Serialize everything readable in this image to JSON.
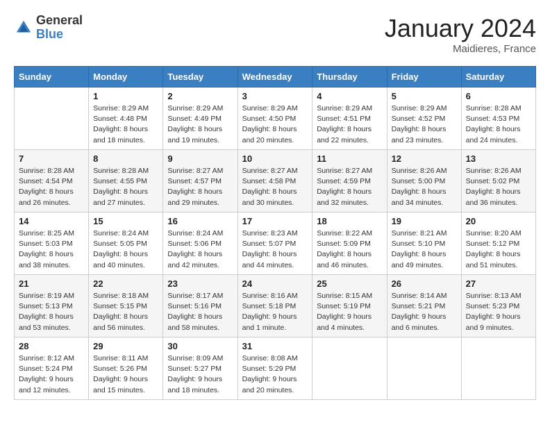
{
  "header": {
    "logo_general": "General",
    "logo_blue": "Blue",
    "month_title": "January 2024",
    "location": "Maidieres, France"
  },
  "weekdays": [
    "Sunday",
    "Monday",
    "Tuesday",
    "Wednesday",
    "Thursday",
    "Friday",
    "Saturday"
  ],
  "weeks": [
    [
      {
        "day": "",
        "sunrise": "",
        "sunset": "",
        "daylight": ""
      },
      {
        "day": "1",
        "sunrise": "Sunrise: 8:29 AM",
        "sunset": "Sunset: 4:48 PM",
        "daylight": "Daylight: 8 hours and 18 minutes."
      },
      {
        "day": "2",
        "sunrise": "Sunrise: 8:29 AM",
        "sunset": "Sunset: 4:49 PM",
        "daylight": "Daylight: 8 hours and 19 minutes."
      },
      {
        "day": "3",
        "sunrise": "Sunrise: 8:29 AM",
        "sunset": "Sunset: 4:50 PM",
        "daylight": "Daylight: 8 hours and 20 minutes."
      },
      {
        "day": "4",
        "sunrise": "Sunrise: 8:29 AM",
        "sunset": "Sunset: 4:51 PM",
        "daylight": "Daylight: 8 hours and 22 minutes."
      },
      {
        "day": "5",
        "sunrise": "Sunrise: 8:29 AM",
        "sunset": "Sunset: 4:52 PM",
        "daylight": "Daylight: 8 hours and 23 minutes."
      },
      {
        "day": "6",
        "sunrise": "Sunrise: 8:28 AM",
        "sunset": "Sunset: 4:53 PM",
        "daylight": "Daylight: 8 hours and 24 minutes."
      }
    ],
    [
      {
        "day": "7",
        "sunrise": "Sunrise: 8:28 AM",
        "sunset": "Sunset: 4:54 PM",
        "daylight": "Daylight: 8 hours and 26 minutes."
      },
      {
        "day": "8",
        "sunrise": "Sunrise: 8:28 AM",
        "sunset": "Sunset: 4:55 PM",
        "daylight": "Daylight: 8 hours and 27 minutes."
      },
      {
        "day": "9",
        "sunrise": "Sunrise: 8:27 AM",
        "sunset": "Sunset: 4:57 PM",
        "daylight": "Daylight: 8 hours and 29 minutes."
      },
      {
        "day": "10",
        "sunrise": "Sunrise: 8:27 AM",
        "sunset": "Sunset: 4:58 PM",
        "daylight": "Daylight: 8 hours and 30 minutes."
      },
      {
        "day": "11",
        "sunrise": "Sunrise: 8:27 AM",
        "sunset": "Sunset: 4:59 PM",
        "daylight": "Daylight: 8 hours and 32 minutes."
      },
      {
        "day": "12",
        "sunrise": "Sunrise: 8:26 AM",
        "sunset": "Sunset: 5:00 PM",
        "daylight": "Daylight: 8 hours and 34 minutes."
      },
      {
        "day": "13",
        "sunrise": "Sunrise: 8:26 AM",
        "sunset": "Sunset: 5:02 PM",
        "daylight": "Daylight: 8 hours and 36 minutes."
      }
    ],
    [
      {
        "day": "14",
        "sunrise": "Sunrise: 8:25 AM",
        "sunset": "Sunset: 5:03 PM",
        "daylight": "Daylight: 8 hours and 38 minutes."
      },
      {
        "day": "15",
        "sunrise": "Sunrise: 8:24 AM",
        "sunset": "Sunset: 5:05 PM",
        "daylight": "Daylight: 8 hours and 40 minutes."
      },
      {
        "day": "16",
        "sunrise": "Sunrise: 8:24 AM",
        "sunset": "Sunset: 5:06 PM",
        "daylight": "Daylight: 8 hours and 42 minutes."
      },
      {
        "day": "17",
        "sunrise": "Sunrise: 8:23 AM",
        "sunset": "Sunset: 5:07 PM",
        "daylight": "Daylight: 8 hours and 44 minutes."
      },
      {
        "day": "18",
        "sunrise": "Sunrise: 8:22 AM",
        "sunset": "Sunset: 5:09 PM",
        "daylight": "Daylight: 8 hours and 46 minutes."
      },
      {
        "day": "19",
        "sunrise": "Sunrise: 8:21 AM",
        "sunset": "Sunset: 5:10 PM",
        "daylight": "Daylight: 8 hours and 49 minutes."
      },
      {
        "day": "20",
        "sunrise": "Sunrise: 8:20 AM",
        "sunset": "Sunset: 5:12 PM",
        "daylight": "Daylight: 8 hours and 51 minutes."
      }
    ],
    [
      {
        "day": "21",
        "sunrise": "Sunrise: 8:19 AM",
        "sunset": "Sunset: 5:13 PM",
        "daylight": "Daylight: 8 hours and 53 minutes."
      },
      {
        "day": "22",
        "sunrise": "Sunrise: 8:18 AM",
        "sunset": "Sunset: 5:15 PM",
        "daylight": "Daylight: 8 hours and 56 minutes."
      },
      {
        "day": "23",
        "sunrise": "Sunrise: 8:17 AM",
        "sunset": "Sunset: 5:16 PM",
        "daylight": "Daylight: 8 hours and 58 minutes."
      },
      {
        "day": "24",
        "sunrise": "Sunrise: 8:16 AM",
        "sunset": "Sunset: 5:18 PM",
        "daylight": "Daylight: 9 hours and 1 minute."
      },
      {
        "day": "25",
        "sunrise": "Sunrise: 8:15 AM",
        "sunset": "Sunset: 5:19 PM",
        "daylight": "Daylight: 9 hours and 4 minutes."
      },
      {
        "day": "26",
        "sunrise": "Sunrise: 8:14 AM",
        "sunset": "Sunset: 5:21 PM",
        "daylight": "Daylight: 9 hours and 6 minutes."
      },
      {
        "day": "27",
        "sunrise": "Sunrise: 8:13 AM",
        "sunset": "Sunset: 5:23 PM",
        "daylight": "Daylight: 9 hours and 9 minutes."
      }
    ],
    [
      {
        "day": "28",
        "sunrise": "Sunrise: 8:12 AM",
        "sunset": "Sunset: 5:24 PM",
        "daylight": "Daylight: 9 hours and 12 minutes."
      },
      {
        "day": "29",
        "sunrise": "Sunrise: 8:11 AM",
        "sunset": "Sunset: 5:26 PM",
        "daylight": "Daylight: 9 hours and 15 minutes."
      },
      {
        "day": "30",
        "sunrise": "Sunrise: 8:09 AM",
        "sunset": "Sunset: 5:27 PM",
        "daylight": "Daylight: 9 hours and 18 minutes."
      },
      {
        "day": "31",
        "sunrise": "Sunrise: 8:08 AM",
        "sunset": "Sunset: 5:29 PM",
        "daylight": "Daylight: 9 hours and 20 minutes."
      },
      {
        "day": "",
        "sunrise": "",
        "sunset": "",
        "daylight": ""
      },
      {
        "day": "",
        "sunrise": "",
        "sunset": "",
        "daylight": ""
      },
      {
        "day": "",
        "sunrise": "",
        "sunset": "",
        "daylight": ""
      }
    ]
  ]
}
